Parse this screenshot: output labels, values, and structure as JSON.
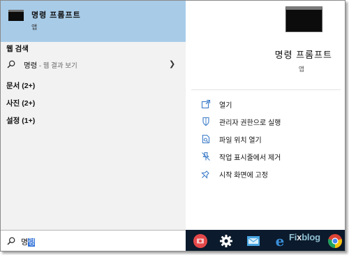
{
  "best_match": {
    "name": "명령 프롬프트",
    "type": "앱"
  },
  "web_section": {
    "header": "웹 검색",
    "query": "명령",
    "hint": " - 웹 결과 보기"
  },
  "categories": [
    {
      "label": "문서 (2+)"
    },
    {
      "label": "사진 (2+)"
    },
    {
      "label": "설정 (1+)"
    }
  ],
  "detail": {
    "title": "명령 프롬프트",
    "type": "앱"
  },
  "actions": [
    {
      "label": "열기",
      "icon": "open-icon"
    },
    {
      "label": "관리자 권한으로 실행",
      "icon": "admin-shield-icon"
    },
    {
      "label": "파일 위치 열기",
      "icon": "file-location-icon"
    },
    {
      "label": "작업 표시줄에서 제거",
      "icon": "unpin-taskbar-icon"
    },
    {
      "label": "시작 화면에 고정",
      "icon": "pin-start-icon"
    }
  ],
  "search": {
    "prefix": "명",
    "selected": "령"
  },
  "taskbar": {
    "icons": [
      "photos-app-icon",
      "settings-gear-icon",
      "mail-app-icon",
      "edge-browser-icon",
      "chrome-icon"
    ],
    "watermark_a": "Fi",
    "watermark_b": "x",
    "watermark_c": "blog"
  },
  "colors": {
    "highlight": "#a8cce8",
    "accent": "#4a8dcf",
    "taskbar": "#0b1a2c"
  }
}
